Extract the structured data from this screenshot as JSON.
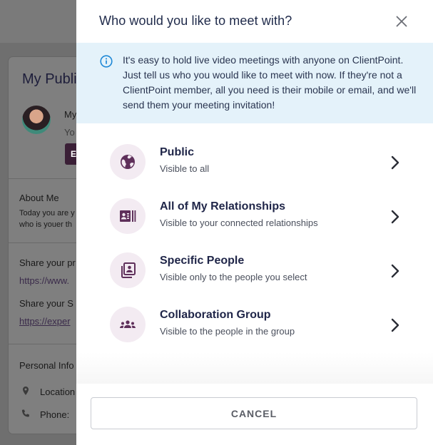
{
  "background": {
    "title": "My Publi",
    "profile_name": "My",
    "profile_sub": "Yo",
    "profile_button": "E",
    "about_heading": "About Me",
    "about_line1": "Today you are y",
    "about_line2": "who is youer th",
    "share_profile_heading": "Share your pr",
    "share_profile_link": "https://www.",
    "share_second_heading": "Share your S",
    "share_second_link": "https://exper",
    "personal_info_heading": "Personal Info",
    "location_label": "Location",
    "phone_label": "Phone:"
  },
  "modal": {
    "title": "Who would you like to meet with?",
    "close_icon": "close-icon",
    "info_icon": "info-icon",
    "info_text": "It's easy to hold live video meetings with anyone on ClientPoint. Just tell us who you would like to meet with now. If they're not a ClientPoint member, all you need is their mobile or email, and we'll send them your meeting invitation!",
    "options": [
      {
        "title": "Public",
        "description": "Visible to all",
        "icon": "globe-icon"
      },
      {
        "title": "All of My Relationships",
        "description": "Visible to your connected relationships",
        "icon": "contact-card-icon"
      },
      {
        "title": "Specific People",
        "description": "Visible only to the people you select",
        "icon": "contacts-book-icon"
      },
      {
        "title": "Collaboration Group",
        "description": "Visible to the people in the group",
        "icon": "group-icon"
      }
    ],
    "cancel_label": "CANCEL"
  },
  "colors": {
    "accent": "#5e2f5a",
    "icon_circle": "#f3ebf2",
    "info_background": "#e4f2fa",
    "info_icon": "#1e88d6",
    "title_text": "#1f2548"
  }
}
